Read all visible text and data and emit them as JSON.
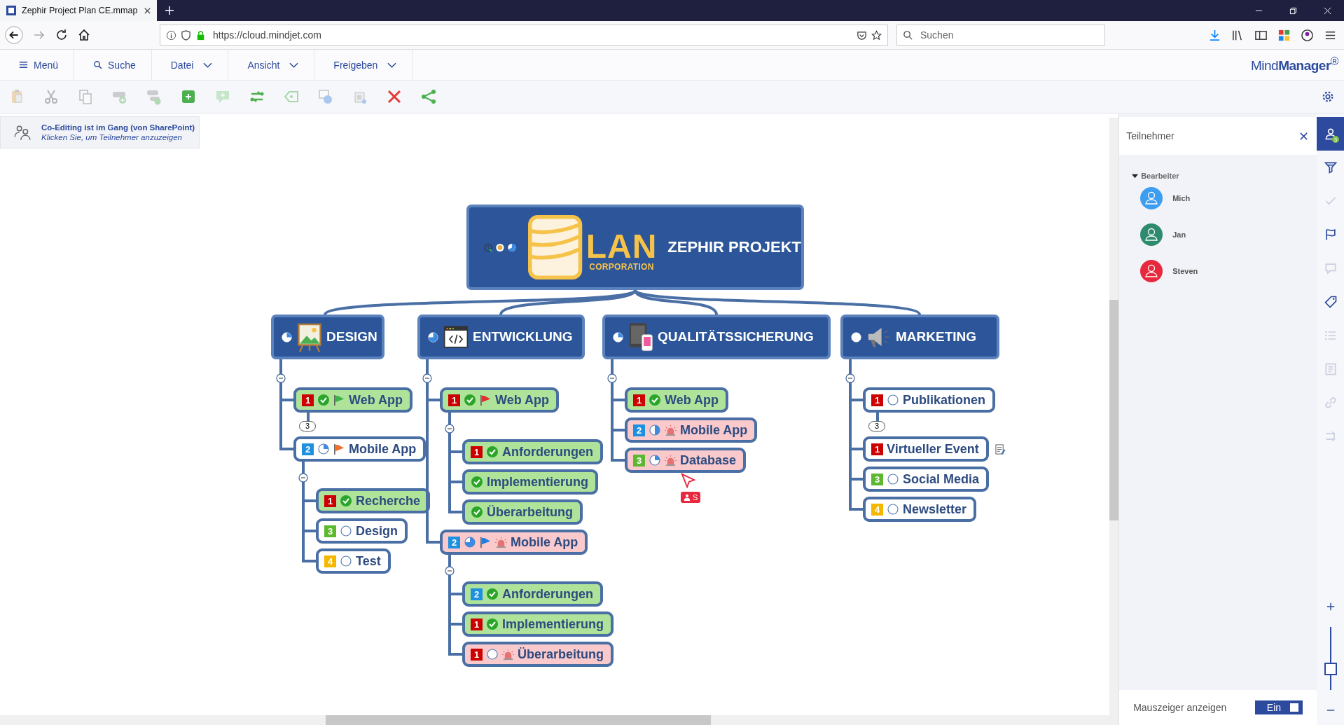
{
  "browser": {
    "tab": {
      "title": "Zephir Project Plan CE.mmap"
    },
    "url": "https://cloud.mindjet.com",
    "search": {
      "placeholder": "Suchen"
    }
  },
  "menu": [
    {
      "label": "Menü",
      "kind": "menu"
    },
    {
      "label": "Suche",
      "kind": "search"
    },
    {
      "label": "Datei",
      "kind": "dropdown"
    },
    {
      "label": "Ansicht",
      "kind": "dropdown"
    },
    {
      "label": "Freigeben",
      "kind": "dropdown"
    }
  ],
  "brand": "Mind**Manager**$^{®}$",
  "toolbar": [
    {
      "disabled": true
    },
    {
      "disabled": true
    },
    {
      "disabled": true
    },
    {
      "disabled": true
    },
    {
      "disabled": true
    },
    {
      "disabled": false
    },
    {
      "disabled": true
    },
    {
      "disabled": false
    },
    {
      "disabled": true
    },
    {
      "disabled": true
    },
    {
      "disabled": true
    },
    {
      "disabled": false
    },
    {
      "disabled": false
    }
  ],
  "banner": {
    "title": "Co-Editing ist im Gang (von SharePoint)",
    "hint": "Klicken Sie, um Teilnehmer anzuzeigen"
  },
  "map": {
    "central": {
      "logo_word": "LAN",
      "logo_sub": "CORPORATION",
      "title": "ZEPHIR PROJEKT"
    },
    "branches": [
      {
        "title": "DESIGN",
        "progress": {
          "kind": "quarter"
        },
        "children": [
          {
            "label": "Web App",
            "kind": "done",
            "priority": {
              "label": "1",
              "color": "#cc0000"
            },
            "progress": {
              "kind": "done"
            },
            "flag": {
              "color": "#3cb44b"
            },
            "alarm": false,
            "collapsed_count": "3"
          },
          {
            "label": "Mobile App",
            "kind": "plain",
            "priority": {
              "label": "2",
              "color": "#1e90e0"
            },
            "progress": {
              "kind": "quarter"
            },
            "flag": {
              "color": "#f07030"
            },
            "alarm": false,
            "children": [
              {
                "label": "Recherche",
                "kind": "done",
                "priority": {
                  "label": "1",
                  "color": "#cc0000"
                },
                "progress": {
                  "kind": "done"
                },
                "alarm": false
              },
              {
                "label": "Design",
                "kind": "plain",
                "priority": {
                  "label": "3",
                  "color": "#5cb82e"
                },
                "progress": {
                  "kind": "open"
                },
                "alarm": false
              },
              {
                "label": "Test",
                "kind": "plain",
                "priority": {
                  "label": "4",
                  "color": "#f5b800"
                },
                "progress": {
                  "kind": "open"
                },
                "alarm": false
              }
            ]
          }
        ]
      },
      {
        "title": "ENTWICKLUNG",
        "progress": {
          "kind": "most"
        },
        "children": [
          {
            "label": "Web App",
            "kind": "done",
            "priority": {
              "label": "1",
              "color": "#cc0000"
            },
            "progress": {
              "kind": "done"
            },
            "flag": {
              "color": "#e03030"
            },
            "alarm": false,
            "children": [
              {
                "label": "Anforderungen",
                "kind": "done",
                "priority": {
                  "label": "1",
                  "color": "#cc0000"
                },
                "progress": {
                  "kind": "done"
                },
                "alarm": false
              },
              {
                "label": "Implementierung",
                "kind": "done",
                "progress": {
                  "kind": "done"
                },
                "alarm": false
              },
              {
                "label": "Überarbeitung",
                "kind": "done",
                "progress": {
                  "kind": "done"
                },
                "alarm": false
              }
            ]
          },
          {
            "label": "Mobile App",
            "kind": "risk",
            "priority": {
              "label": "2",
              "color": "#1e90e0"
            },
            "progress": {
              "kind": "most"
            },
            "flag": {
              "color": "#1e7fe0"
            },
            "alarm": true,
            "children": [
              {
                "label": "Anforderungen",
                "kind": "done",
                "priority": {
                  "label": "2",
                  "color": "#1e90e0"
                },
                "progress": {
                  "kind": "done"
                },
                "alarm": false
              },
              {
                "label": "Implementierung",
                "kind": "done",
                "priority": {
                  "label": "1",
                  "color": "#cc0000"
                },
                "progress": {
                  "kind": "done"
                },
                "alarm": false
              },
              {
                "label": "Überarbeitung",
                "kind": "risk",
                "priority": {
                  "label": "1",
                  "color": "#cc0000"
                },
                "progress": {
                  "kind": "open"
                },
                "alarm": true
              }
            ]
          }
        ]
      },
      {
        "title": "QUALITÄTSSICHERUNG",
        "progress": {
          "kind": "quarter"
        },
        "children": [
          {
            "label": "Web App",
            "kind": "done",
            "priority": {
              "label": "1",
              "color": "#cc0000"
            },
            "progress": {
              "kind": "done"
            },
            "alarm": false
          },
          {
            "label": "Mobile App",
            "kind": "risk",
            "priority": {
              "label": "2",
              "color": "#1e90e0"
            },
            "progress": {
              "kind": "half"
            },
            "alarm": true
          },
          {
            "label": "Database",
            "kind": "risk",
            "priority": {
              "label": "3",
              "color": "#5cb82e"
            },
            "progress": {
              "kind": "quarter"
            },
            "alarm": true,
            "cursor": {
              "initial": "S",
              "color": "#e8283c"
            }
          }
        ]
      },
      {
        "title": "MARKETING",
        "progress": {
          "kind": "open"
        },
        "children": [
          {
            "label": "Publikationen",
            "kind": "plain",
            "priority": {
              "label": "1",
              "color": "#cc0000"
            },
            "progress": {
              "kind": "open"
            },
            "alarm": false,
            "collapsed_count": "3"
          },
          {
            "label": "Virtueller Event",
            "kind": "plain",
            "priority": {
              "label": "1",
              "color": "#cc0000"
            },
            "alarm": false,
            "note": true
          },
          {
            "label": "Social Media",
            "kind": "plain",
            "priority": {
              "label": "3",
              "color": "#5cb82e"
            },
            "progress": {
              "kind": "open"
            },
            "alarm": false
          },
          {
            "label": "Newsletter",
            "kind": "plain",
            "priority": {
              "label": "4",
              "color": "#f5b800"
            },
            "progress": {
              "kind": "open"
            },
            "alarm": false
          }
        ]
      }
    ]
  },
  "panel": {
    "title": "Teilnehmer",
    "group": {
      "label": "Bearbeiter",
      "expanded": true
    },
    "participants": [
      {
        "name": "Mich",
        "color": "#3d9df0"
      },
      {
        "name": "Jan",
        "color": "#2e8b6e"
      },
      {
        "name": "Steven",
        "color": "#e8283c"
      }
    ],
    "pointer_toggle": {
      "label": "Mauszeiger anzeigen",
      "value": "Ein",
      "on": true
    }
  },
  "rail": [
    {
      "selected": true,
      "disabled": false,
      "badge": "3"
    },
    {
      "selected": false,
      "disabled": false
    },
    {
      "selected": false,
      "disabled": true
    },
    {
      "selected": false,
      "disabled": false
    },
    {
      "selected": false,
      "disabled": true
    },
    {
      "selected": false,
      "disabled": false
    },
    {
      "selected": false,
      "disabled": true
    },
    {
      "selected": false,
      "disabled": true
    },
    {
      "selected": false,
      "disabled": true
    },
    {
      "selected": false,
      "disabled": true
    }
  ],
  "zoom": {
    "level": 0.3
  }
}
